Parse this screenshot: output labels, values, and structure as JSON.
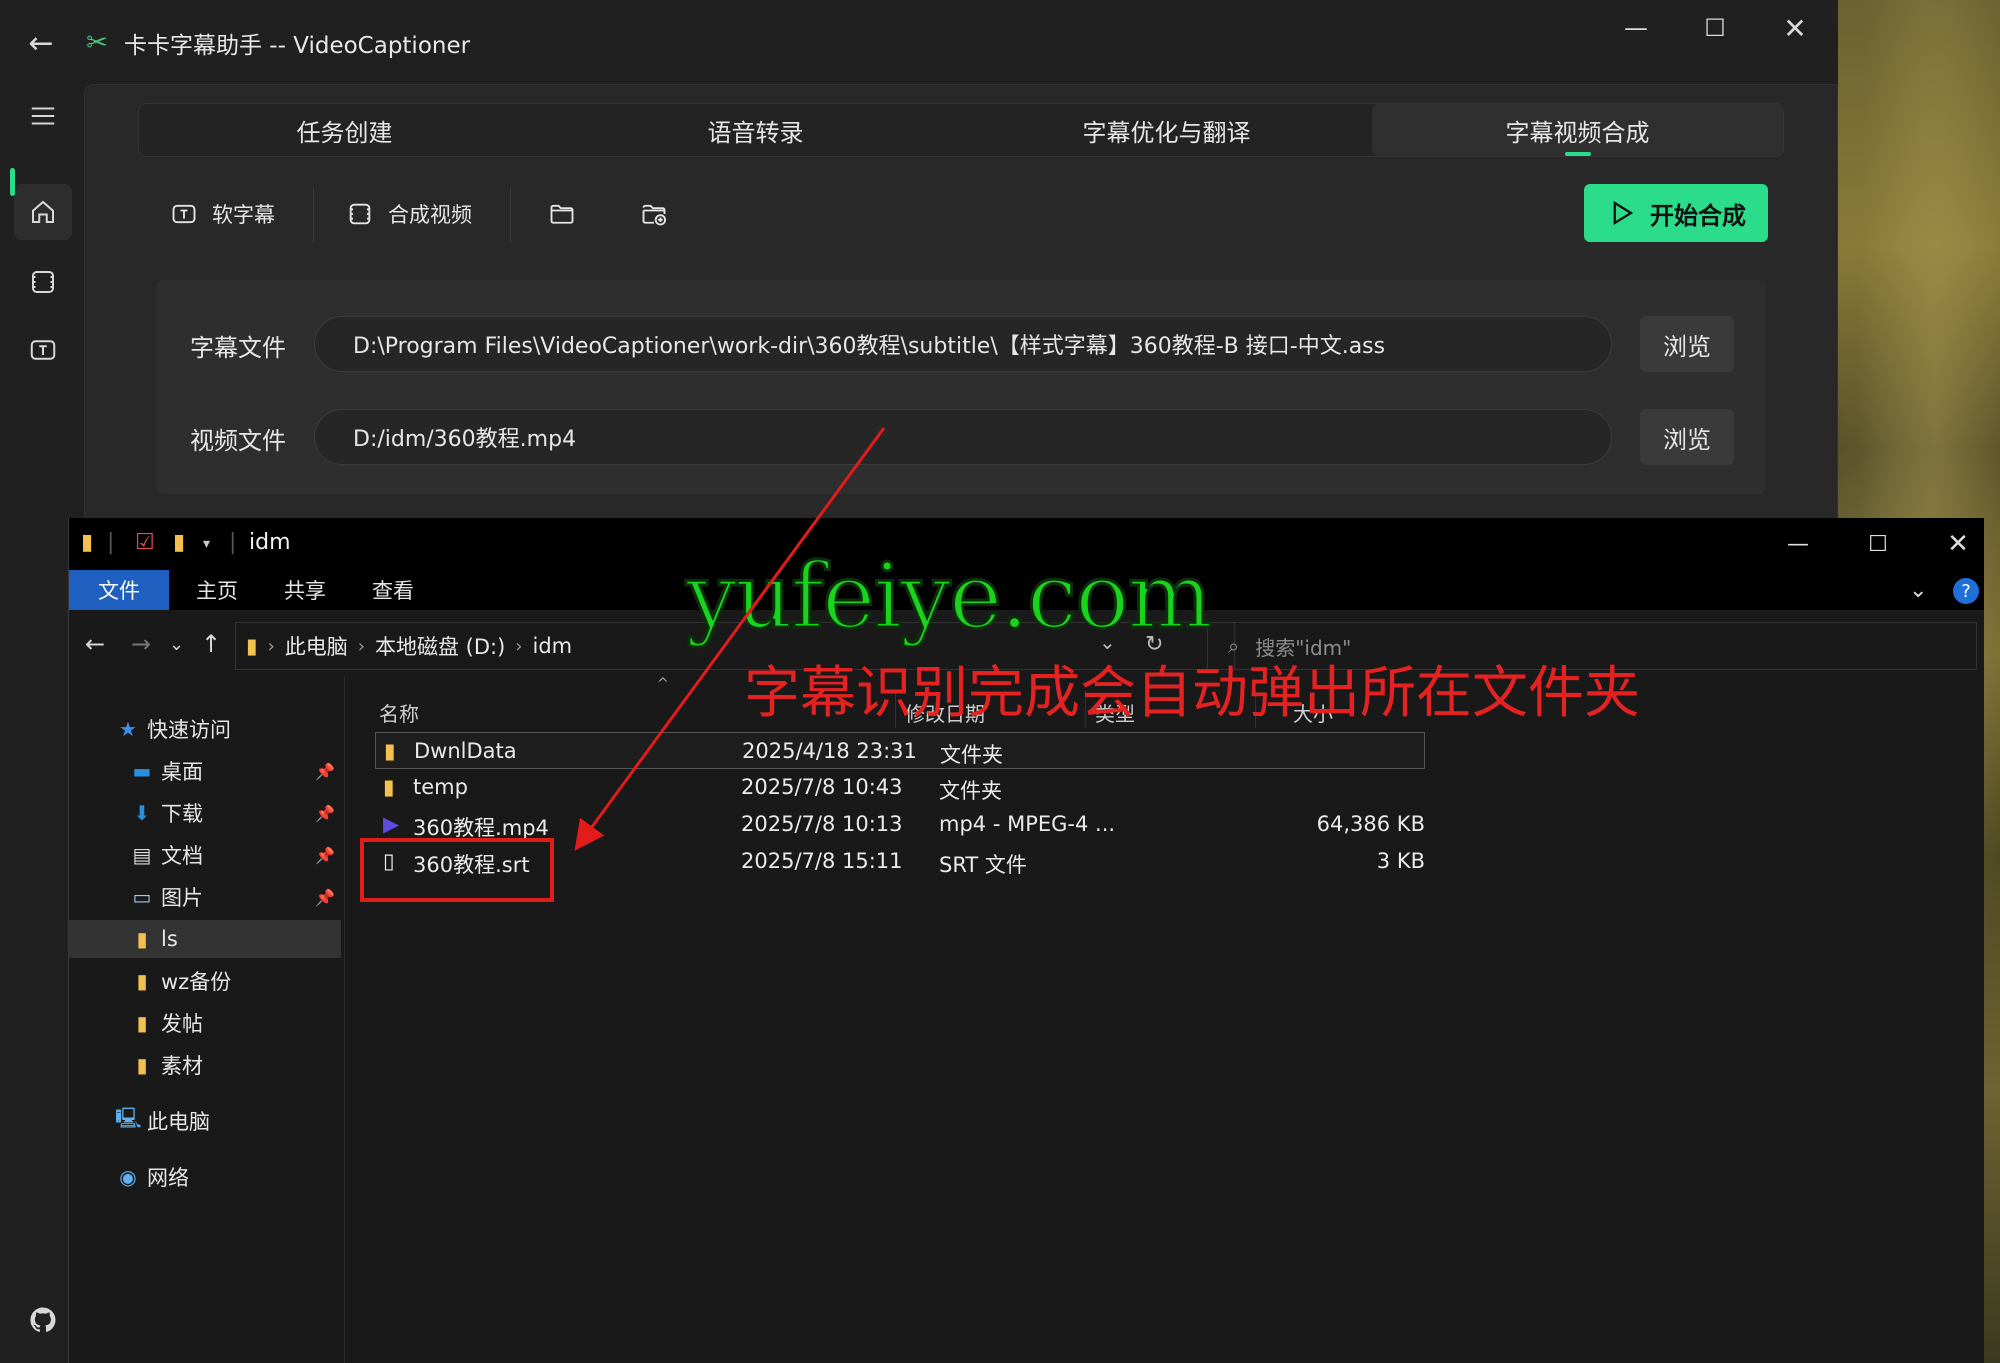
{
  "app": {
    "title": "卡卡字幕助手 -- VideoCaptioner",
    "tabs": [
      "任务创建",
      "语音转录",
      "字幕优化与翻译",
      "字幕视频合成"
    ],
    "active_tab": 3,
    "toolbar": {
      "soft_subtitle_label": "软字幕",
      "merge_video_label": "合成视频",
      "start_button_label": "开始合成"
    },
    "subtitle_file": {
      "label": "字幕文件",
      "value": "D:\\Program Files\\VideoCaptioner\\work-dir\\360教程\\subtitle\\【样式字幕】360教程-B 接口-中文.ass",
      "browse_label": "浏览"
    },
    "video_file": {
      "label": "视频文件",
      "value": "D:/idm/360教程.mp4",
      "browse_label": "浏览"
    },
    "accent_color": "#2bdc8a"
  },
  "explorer": {
    "title": "idm",
    "ribbon_tabs": {
      "file": "文件",
      "home": "主页",
      "share": "共享",
      "view": "查看"
    },
    "help_label": "?",
    "breadcrumb": [
      "此电脑",
      "本地磁盘 (D:)",
      "idm"
    ],
    "search_placeholder": "搜索\"idm\"",
    "nav": {
      "quick_access": "快速访问",
      "desktop": "桌面",
      "downloads": "下载",
      "documents": "文档",
      "pictures": "图片",
      "ls": "ls",
      "wz_backup": "wz备份",
      "posts": "发帖",
      "materials": "素材",
      "this_pc": "此电脑",
      "network": "网络"
    },
    "columns": {
      "name": "名称",
      "modified": "修改日期",
      "type": "类型",
      "size": "大小"
    },
    "files": [
      {
        "name": "DwnlData",
        "modified": "2025/4/18 23:31",
        "type": "文件夹",
        "size": "",
        "icon": "folder-icon"
      },
      {
        "name": "temp",
        "modified": "2025/7/8 10:43",
        "type": "文件夹",
        "size": "",
        "icon": "folder-icon"
      },
      {
        "name": "360教程.mp4",
        "modified": "2025/7/8 10:13",
        "type": "mp4 - MPEG-4 ...",
        "size": "64,386 KB",
        "icon": "video-file-icon"
      },
      {
        "name": "360教程.srt",
        "modified": "2025/7/8 15:11",
        "type": "SRT 文件",
        "size": "3 KB",
        "icon": "text-file-icon"
      }
    ]
  },
  "overlay": {
    "watermark": "yufeiye.com",
    "annotation": "字幕识别完成会自动弹出所在文件夹",
    "annotation_color": "#e52222",
    "watermark_color": "#19d41c"
  }
}
